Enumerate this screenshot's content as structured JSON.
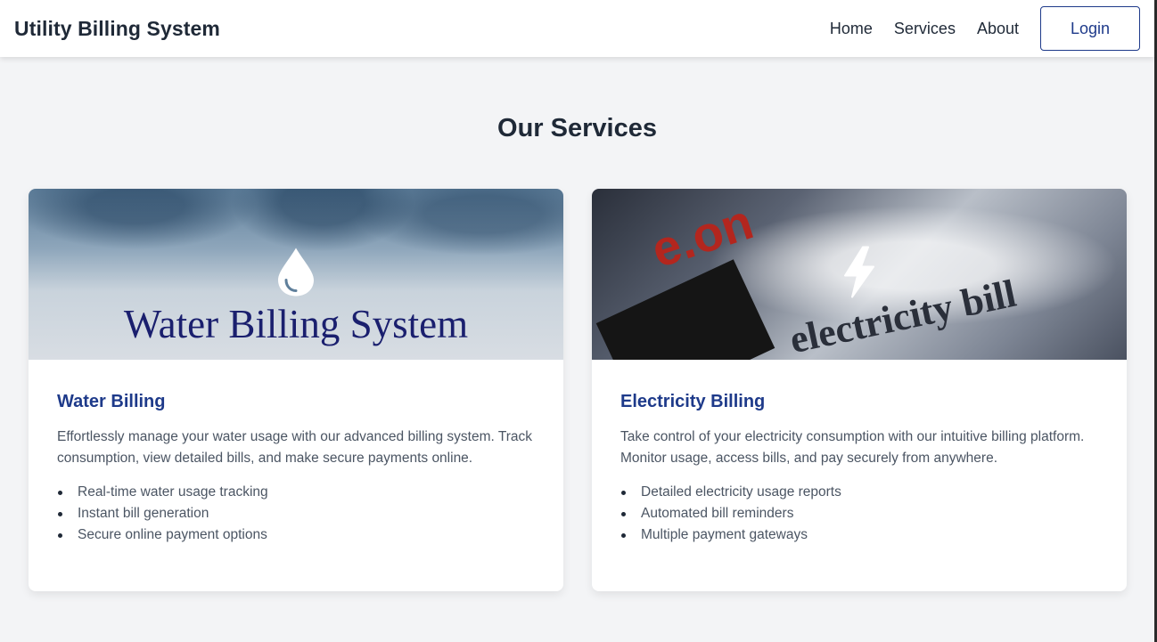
{
  "navbar": {
    "brand": "Utility Billing System",
    "links": [
      "Home",
      "Services",
      "About"
    ],
    "login_label": "Login"
  },
  "services": {
    "title": "Our Services",
    "cards": [
      {
        "image_caption": "Water Billing System",
        "icon": "water-drop-icon",
        "title": "Water Billing",
        "description": "Effortlessly manage your water usage with our advanced billing system. Track consumption, view detailed bills, and make secure payments online.",
        "features": [
          "Real-time water usage tracking",
          "Instant bill generation",
          "Secure online payment options"
        ]
      },
      {
        "image_caption": "electricity bill",
        "image_logo": "e.on",
        "icon": "lightning-bolt-icon",
        "title": "Electricity Billing",
        "description": "Take control of your electricity consumption with our intuitive billing platform. Monitor usage, access bills, and pay securely from anywhere.",
        "features": [
          "Detailed electricity usage reports",
          "Automated bill reminders",
          "Multiple payment gateways"
        ]
      }
    ]
  },
  "colors": {
    "background": "#f3f4f6",
    "accent": "#1e3a8a",
    "text": "#1f2937",
    "muted_text": "#4b5563"
  }
}
